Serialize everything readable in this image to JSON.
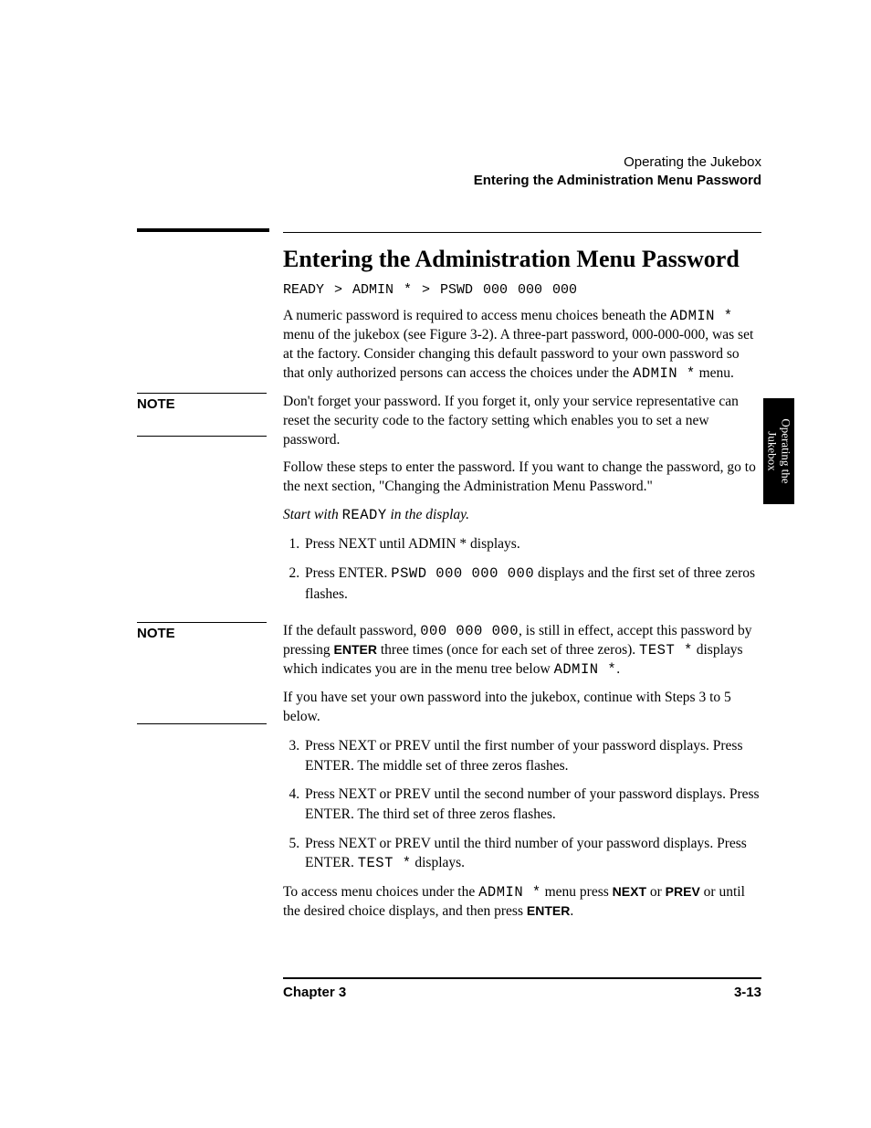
{
  "header": {
    "chapter_title": "Operating the Jukebox",
    "section_title": "Entering the Administration Menu Password"
  },
  "side_tab": {
    "line1": "Operating the",
    "line2": "Jukebox"
  },
  "main": {
    "heading": "Entering the Administration Menu Password",
    "breadcrumb": "READY   >   ADMIN *   >   PSWD 000 000 000",
    "intro_a": "A numeric password is required to access menu choices beneath the ",
    "intro_mono_1": "ADMIN *",
    "intro_b": " menu of the jukebox (see Figure 3-2). A three-part password, 000-000-000, was set at the factory. Consider changing this default password to your own password so that only authorized persons can access the choices under the ",
    "intro_mono_2": "ADMIN *",
    "intro_c": " menu.",
    "note1_label": "NOTE",
    "note1_text": "Don't forget your password. If you forget it, only your service representative can reset the security code to the factory setting which enables you to set a new password.",
    "follow": "Follow these steps to enter the password. If you want to change the password, go to the next section, \"Changing the Administration Menu Password.\"",
    "start_a": "Start with ",
    "start_mono": "READY",
    "start_b": " in the display.",
    "step1_a": "Press ",
    "step1_k1": "NEXT",
    "step1_b": " until ",
    "step1_k2": "ADMIN *",
    "step1_c": " displays.",
    "step2_a": "Press ",
    "step2_k1": "ENTER",
    "step2_b": ". ",
    "step2_mono": "PSWD 000 000 000",
    "step2_c": " displays and the first set of three zeros flashes.",
    "note2_label": "NOTE",
    "note2_a": "If the default password, ",
    "note2_mono1": "000 000 000",
    "note2_b": ", is still in effect, accept this password by pressing ",
    "note2_k1": "ENTER",
    "note2_c": " three times (once for each set of three zeros).  ",
    "note2_mono2": "TEST *",
    "note2_d": " displays which indicates you are in the menu tree below ",
    "note2_mono3": "ADMIN *",
    "note2_e": ".",
    "note2_p2": "If you have set your own password into the jukebox, continue with Steps 3 to 5 below.",
    "step3_a": "Press ",
    "step3_k1": "NEXT",
    "step3_b": " or ",
    "step3_k2": "PREV",
    "step3_c": " until the first number of your password displays. Press ",
    "step3_k3": "ENTER",
    "step3_d": ". The middle set of three zeros flashes.",
    "step4_a": "Press ",
    "step4_k1": "NEXT",
    "step4_b": " or ",
    "step4_k2": "PREV",
    "step4_c": " until the second number of your password displays. Press ",
    "step4_k3": "ENTER",
    "step4_d": ". The third set of three zeros flashes.",
    "step5_a": "Press ",
    "step5_k1": "NEXT",
    "step5_b": " or ",
    "step5_k2": "PREV",
    "step5_c": " until the third number of your password displays. Press ",
    "step5_k3": "ENTER",
    "step5_d": ". ",
    "step5_mono": "TEST *",
    "step5_e": " displays.",
    "closing_a": "To access menu choices under the ",
    "closing_mono": "ADMIN *",
    "closing_b": " menu press ",
    "closing_k1": "NEXT",
    "closing_c": " or ",
    "closing_k2": "PREV",
    "closing_d": " or until the desired choice displays, and then press ",
    "closing_k3": "ENTER",
    "closing_e": "."
  },
  "footer": {
    "left": "Chapter 3",
    "right": "3-13"
  }
}
